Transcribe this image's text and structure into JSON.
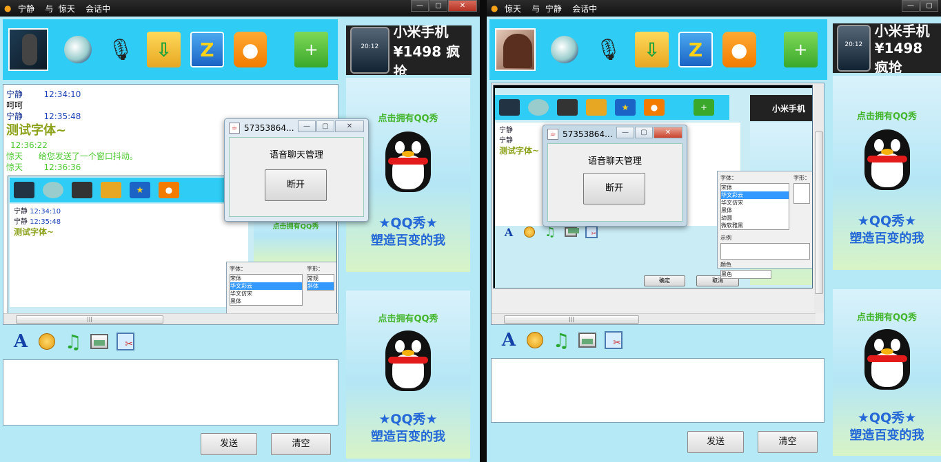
{
  "colors": {
    "toolbar": "#2fcdf5",
    "client": "#b5e9f5",
    "name": "#0a2a8f",
    "big_text": "#8ca21b",
    "green_text": "#4bc92f"
  },
  "window1": {
    "title": "宁静    与  惊天    会话中",
    "chat": [
      {
        "name": "宁静",
        "time": "12:34:10",
        "body": "呵呵"
      },
      {
        "name": "宁静",
        "time": "12:35:48",
        "body": "测试字体~"
      },
      {
        "time": "12:36:22",
        "line": "惊天      给您发送了一个窗口抖动。"
      },
      {
        "name": "惊天",
        "time": "12:36:36"
      }
    ],
    "send": "发送",
    "clear": "清空"
  },
  "window2": {
    "title": "惊天    与  宁静    会话中",
    "send": "发送",
    "clear": "清空"
  },
  "ad": {
    "phone_line1": "小米手机",
    "phone_line2": "¥1498 疯抢",
    "phone_screen": "20:12",
    "qq_head": "点击拥有QQ秀",
    "qq_show": "★QQ秀★",
    "qq_slogan": "塑造百变的我"
  },
  "dialog": {
    "title": "57353864...",
    "label": "语音聊天管理",
    "button": "断开"
  },
  "nested": {
    "line1": "宁静",
    "time1": "12:34:10",
    "line2": "宁静",
    "time2": "12:35:48",
    "big": "测试字体~",
    "font_label": "字体：",
    "font_items": [
      "宋体",
      "华文彩云",
      "华文仿宋",
      "黑体",
      "幼圆",
      "微软雅黑"
    ],
    "style_label": "字形：",
    "style_items": [
      "常规",
      "斜体"
    ],
    "sample_label": "示例",
    "color_label": "颜色",
    "color_value": "黑色",
    "confirm": "确定",
    "cancel": "取消"
  }
}
